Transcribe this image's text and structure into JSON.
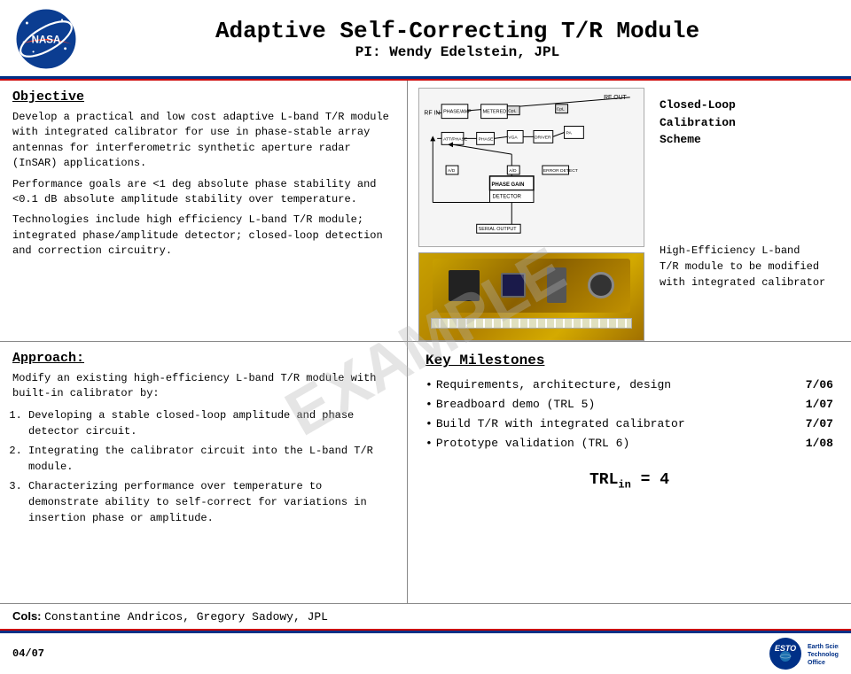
{
  "header": {
    "title": "Adaptive Self-Correcting T/R Module",
    "subtitle": "PI: Wendy Edelstein, JPL"
  },
  "objective": {
    "heading": "Objective",
    "paragraphs": [
      "Develop a practical and low cost  adaptive L-band T/R module with integrated calibrator for use in phase-stable array antennas for interferometric synthetic aperture radar (InSAR) applications.",
      "Performance goals are <1 deg absolute phase stability and <0.1 dB absolute amplitude stability over temperature.",
      "Technologies  include high efficiency L-band T/R module; integrated phase/amplitude detector; closed-loop detection and correction circuitry."
    ]
  },
  "diagram": {
    "calibration_label": "Closed-Loop\nCalibration\nScheme",
    "photo_label": "High-Efficiency L-band\nT/R module to be modified\nwith integrated calibrator",
    "rf_in": "RF IN",
    "rf_out": "RF OUT"
  },
  "approach": {
    "heading": "Approach:",
    "intro": "Modify an existing high-efficiency  L-band T/R module with built-in calibrator by:",
    "steps": [
      "Developing a stable closed-loop amplitude and phase detector circuit.",
      "Integrating the calibrator circuit into the L-band T/R module.",
      "Characterizing performance over temperature to demonstrate ability to self-correct for variations in insertion phase or amplitude."
    ]
  },
  "milestones": {
    "heading": "Key Milestones",
    "items": [
      {
        "label": "Requirements, architecture, design",
        "date": "7/06"
      },
      {
        "label": "Breadboard demo (TRL 5)",
        "date": "1/07"
      },
      {
        "label": "Build T/R with integrated calibrator",
        "date": "7/07"
      },
      {
        "label": "Prototype validation (TRL 6)",
        "date": "1/08"
      }
    ]
  },
  "trl": {
    "text": "TRL",
    "subscript": "in",
    "value": " = 4"
  },
  "footer": {
    "cois_label": "CoIs:",
    "cois_value": " Constantine Andricos, Gregory Sadowy, JPL",
    "date": "04/07"
  },
  "esto": {
    "logo_text": "ESTO",
    "tagline": "Earth Science\nTechnology Office"
  },
  "watermark": "EXAMPLE"
}
